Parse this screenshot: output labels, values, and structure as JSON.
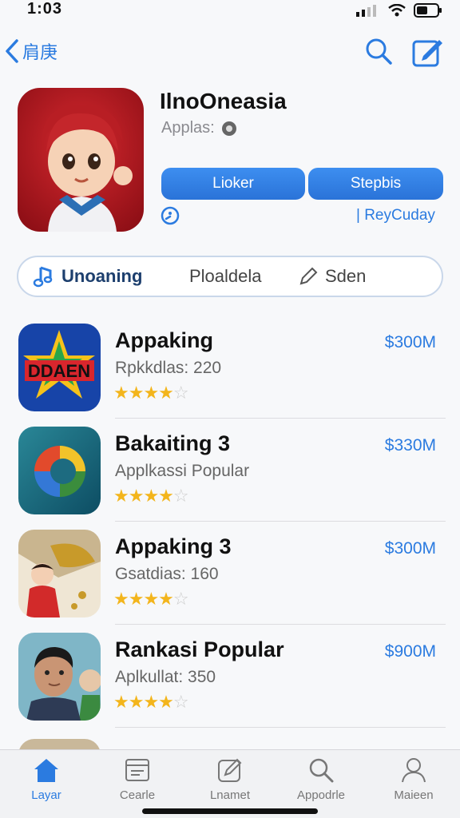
{
  "status_bar": {
    "time": "1:03"
  },
  "nav": {
    "back_label": "肩庚"
  },
  "app": {
    "title": "IlnoOneasia",
    "subtitle": "Applas:",
    "primary_button": "Lioker",
    "secondary_button": "Stepbis",
    "below_right_label": "| ReyCuday"
  },
  "segmented": {
    "items": [
      {
        "label": "Unoaning"
      },
      {
        "label": "Ploaldela"
      },
      {
        "label": "Sden"
      }
    ]
  },
  "list": {
    "items": [
      {
        "title": "Appaking",
        "subtitle": "Rpkkdlas: 220",
        "price": "$300M",
        "rating": 4.5,
        "icon_text": "DDAEN"
      },
      {
        "title": "Bakaiting 3",
        "subtitle": "Applkassi Popular",
        "price": "$330M",
        "rating": 4.5
      },
      {
        "title": "Appaking 3",
        "subtitle": "Gsatdias: 160",
        "price": "$300M",
        "rating": 4.5
      },
      {
        "title": "Rankasi Popular",
        "subtitle": "Aplkullat: 350",
        "price": "$900M",
        "rating": 4.5
      }
    ]
  },
  "tab_bar": {
    "tabs": [
      {
        "label": "Layar",
        "icon": "house-icon",
        "active": true
      },
      {
        "label": "Cearle",
        "icon": "browser-icon",
        "active": false
      },
      {
        "label": "Lnamet",
        "icon": "edit-icon",
        "active": false
      },
      {
        "label": "Appodrle",
        "icon": "search-icon",
        "active": false
      },
      {
        "label": "Maieen",
        "icon": "person-icon",
        "active": false
      }
    ]
  },
  "colors": {
    "accent": "#2b7be0",
    "star": "#f3b51c"
  }
}
